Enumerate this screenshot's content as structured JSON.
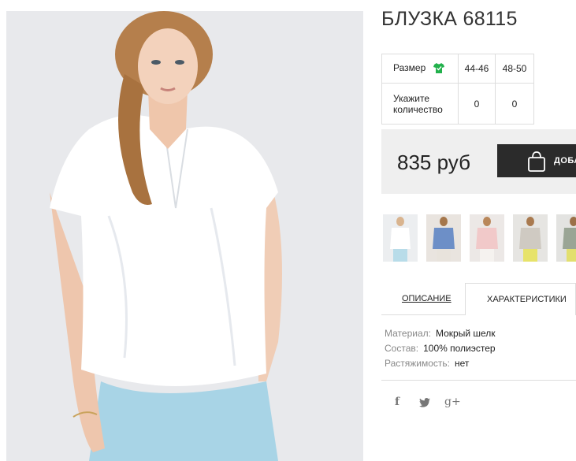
{
  "product": {
    "title": "БЛУЗКА 68115"
  },
  "sizes": {
    "size_label": "Размер",
    "size_icon": "tshirt-icon",
    "size_icon_color": "#22b14c",
    "options": [
      "44-46",
      "48-50"
    ],
    "quantity_label_line1": "Укажите",
    "quantity_label_line2": "количество",
    "quantities": [
      "0",
      "0"
    ]
  },
  "purchase": {
    "price": "835 руб",
    "button_label": "ДОБА",
    "button_icon": "shopping-bag-icon"
  },
  "gallery": {
    "thumbnails": [
      {
        "name": "thumb-white-blouse",
        "top_color": "#ffffff"
      },
      {
        "name": "thumb-blue-blouse",
        "top_color": "#6d8fc7"
      },
      {
        "name": "thumb-pink-blouse",
        "top_color": "#f1c9c9"
      },
      {
        "name": "thumb-grey-blouse",
        "top_color": "#cfcac2"
      },
      {
        "name": "thumb-green-blouse",
        "top_color": "#9aa595"
      }
    ]
  },
  "tabs": {
    "description": "ОПИСАНИЕ",
    "characteristics": "ХАРАКТЕРИСТИКИ",
    "active": "characteristics"
  },
  "specs": [
    {
      "key": "Материал:",
      "value": "Мокрый шелк"
    },
    {
      "key": "Состав:",
      "value": "100% полиэстер"
    },
    {
      "key": "Растяжимость:",
      "value": "нет"
    }
  ],
  "social": {
    "facebook": "f",
    "twitter": "twitter-icon",
    "google_plus": "g+"
  }
}
